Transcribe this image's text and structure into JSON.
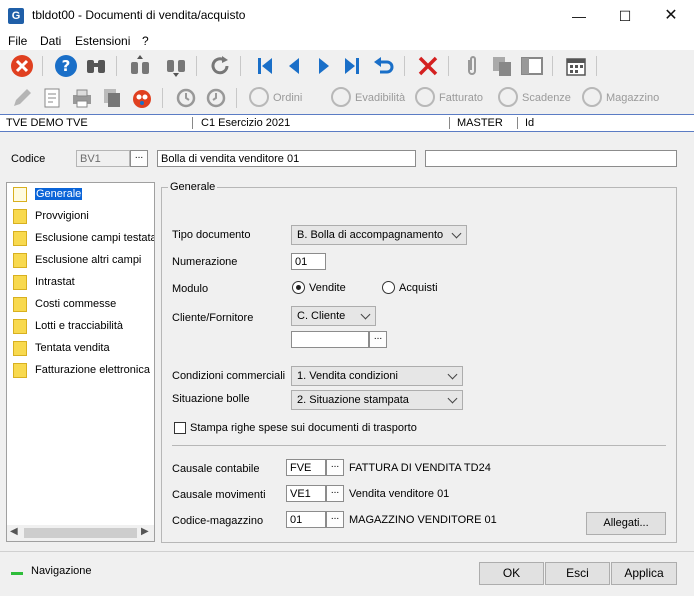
{
  "window": {
    "title": "tbldot00 - Documenti di vendita/acquisto",
    "icon_letter": "G"
  },
  "menu": [
    "File",
    "Dati",
    "Estensioni",
    "?"
  ],
  "toolbar2": {
    "ordini": "Ordini",
    "evadibilita": "Evadibilità",
    "fatturato": "Fatturato",
    "scadenze": "Scadenze",
    "magazzino": "Magazzino"
  },
  "status_strip": {
    "company": "TVE DEMO TVE",
    "esercizio": "C1 Esercizio 2021",
    "user": "MASTER",
    "id": "Id"
  },
  "codice": {
    "label": "Codice",
    "value": "BV1",
    "description": "Bolla di vendita venditore 01",
    "extra": ""
  },
  "tree": {
    "items": [
      "Generale",
      "Provvigioni",
      "Esclusione campi testata",
      "Esclusione altri campi",
      "Intrastat",
      "Costi commesse",
      "Lotti e tracciabilità",
      "Tentata vendita",
      "Fatturazione elettronica"
    ]
  },
  "general": {
    "group_title": "Generale",
    "tipo_documento": {
      "label": "Tipo documento",
      "value": "B. Bolla di accompagnamento"
    },
    "numerazione": {
      "label": "Numerazione",
      "value": "01"
    },
    "modulo": {
      "label": "Modulo",
      "opt_vendite": "Vendite",
      "opt_acquisti": "Acquisti"
    },
    "cliente": {
      "label": "Cliente/Fornitore",
      "value": "C. Cliente",
      "code": ""
    },
    "condizioni": {
      "label": "Condizioni commerciali",
      "value": "1. Vendita condizioni"
    },
    "situazione": {
      "label": "Situazione bolle",
      "value": "2. Situazione stampata"
    },
    "stampa_label": "Stampa righe spese sui documenti di trasporto",
    "causale_contabile": {
      "label": "Causale contabile",
      "code": "FVE",
      "desc": "FATTURA DI VENDITA TD24"
    },
    "causale_movimenti": {
      "label": "Causale movimenti",
      "code": "VE1",
      "desc": "Vendita venditore 01"
    },
    "magazzino": {
      "label": "Codice-magazzino",
      "code": "01",
      "desc": "MAGAZZINO VENDITORE 01"
    },
    "allegati": "Allegati..."
  },
  "footer": {
    "nav": "Navigazione",
    "ok": "OK",
    "esci": "Esci",
    "applica": "Applica"
  },
  "colors": {
    "accent": "#0a64d8",
    "nav_green": "#2ebd3a"
  }
}
